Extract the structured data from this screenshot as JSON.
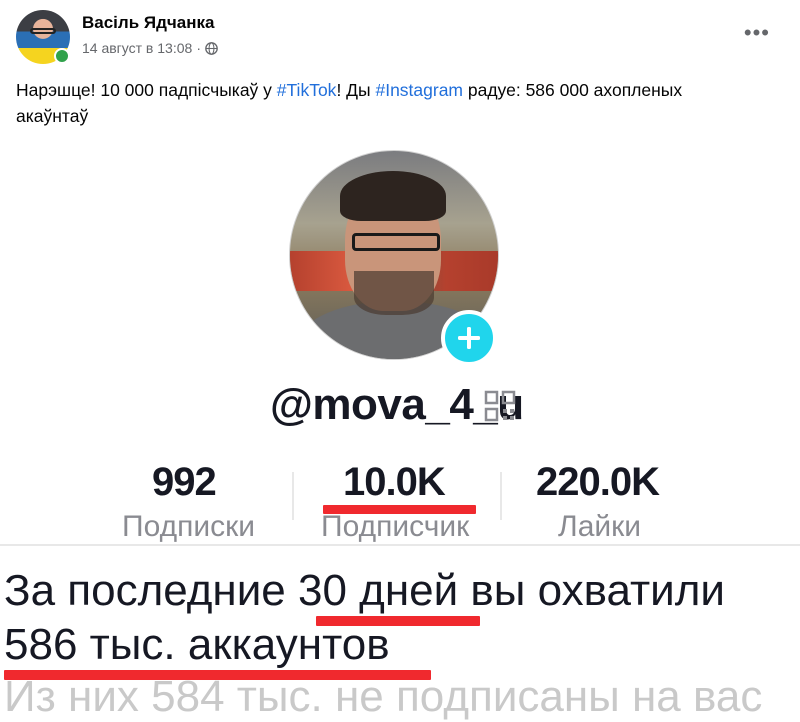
{
  "post": {
    "author": "Васіль Ядчанка",
    "timestamp": "14 август в 13:08",
    "separator": "·",
    "more_label": "•••",
    "text_before": "Нарэшце! 10 000 падпісчыкаў у ",
    "hashtag1": "#TikTok",
    "text_middle": "! Ды ",
    "hashtag2": "#Instagram",
    "text_after": " радуе: 586 000 ахопленых акаўнтаў"
  },
  "tiktok_profile": {
    "username": "@mova_4_u",
    "stats": [
      {
        "value": "992",
        "label": "Подписки"
      },
      {
        "value": "10.0K",
        "label": "Подписчик"
      },
      {
        "value": "220.0K",
        "label": "Лайки"
      }
    ],
    "accent_color": "#20d5ec",
    "highlight_color": "#f0292e"
  },
  "instagram_insights": {
    "line1_before": "За последние ",
    "line1_highlight": "30 дней",
    "line1_after": " вы охватили",
    "line2": "586 тыс. аккаунтов",
    "line3_partial": "Из них 584 тыс. не подписаны на вас"
  },
  "icons": {
    "avatar": "avatar",
    "globe": "globe-icon",
    "more": "more-icon",
    "plus": "plus-icon",
    "qr": "qr-code-icon"
  }
}
